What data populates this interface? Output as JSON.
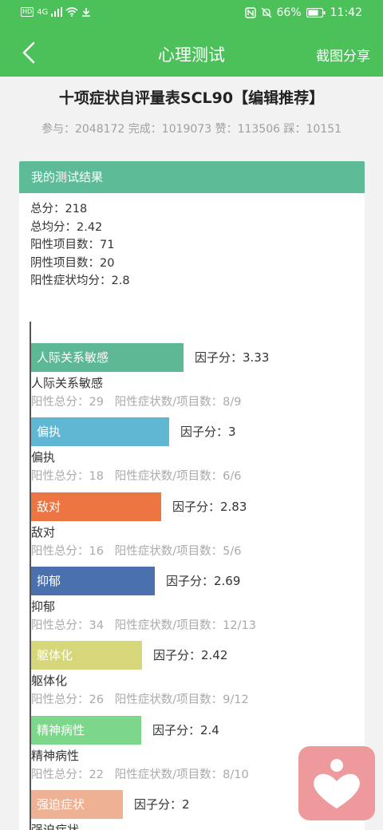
{
  "status_bar": {
    "hd": "HD",
    "signal": "4G",
    "battery": "66%",
    "time": "11:42"
  },
  "app_bar": {
    "title": "心理测试",
    "share": "截图分享"
  },
  "test": {
    "title": "十项症状自评量表SCL90【编辑推荐】",
    "stats": "参与：2048172 完成：1019073 赞：113506 踩：10151"
  },
  "result": {
    "header": "我的测试结果",
    "summary": [
      "总分：218",
      "总均分：2.42",
      "阳性项目数：71",
      "阴性项目数：20",
      "阳性症状均分：2.8"
    ]
  },
  "chart_data": {
    "type": "bar",
    "orientation": "horizontal",
    "categories": [
      "人际关系敏感",
      "偏执",
      "敌对",
      "抑郁",
      "躯体化",
      "精神病性",
      "强迫症状"
    ],
    "values": [
      3.33,
      3,
      2.83,
      2.69,
      2.42,
      2.4,
      2
    ],
    "factor_labels": [
      "因子分：3.33",
      "因子分：3",
      "因子分：2.83",
      "因子分：2.69",
      "因子分：2.42",
      "因子分：2.4",
      "因子分：2"
    ],
    "details": [
      "阳性总分：29   阳性症状数/项目数：8/9",
      "阳性总分：18   阳性症状数/项目数：6/6",
      "阳性总分：16   阳性症状数/项目数：5/6",
      "阳性总分：34   阳性症状数/项目数：12/13",
      "阳性总分：26   阳性症状数/项目数：9/12",
      "阳性总分：22   阳性症状数/项目数：8/10",
      ""
    ],
    "colors": [
      "#5cb895",
      "#5fb7d4",
      "#ec7541",
      "#4a71ad",
      "#d5d77a",
      "#7dd78a",
      "#efb193"
    ]
  }
}
